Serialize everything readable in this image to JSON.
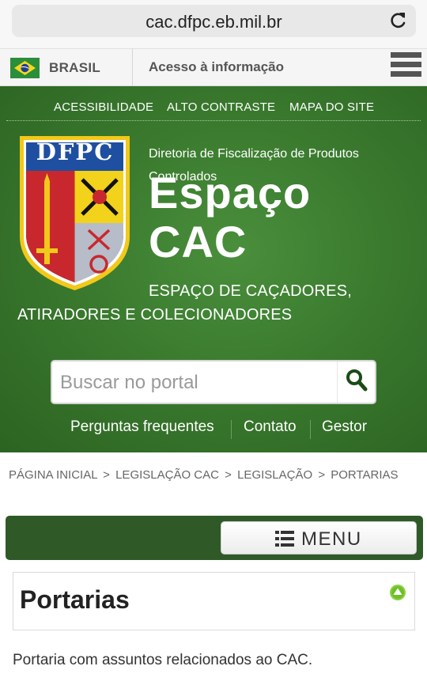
{
  "browser": {
    "url": "cac.dfpc.eb.mil.br",
    "reload_icon": "reload-icon"
  },
  "govbar": {
    "country": "BRASIL",
    "access_info": "Acesso à informação",
    "flag_icon": "brazil-flag-icon",
    "menu_icon": "hamburger-menu-icon"
  },
  "accessibility_links": [
    "ACESSIBILIDADE",
    "ALTO CONTRASTE",
    "MAPA DO SITE"
  ],
  "header": {
    "org_name": "Diretoria de Fiscalização de Produtos Controlados",
    "site_title_line1": "Espaço",
    "site_title_line2": "CAC",
    "subtitle_line1": "ESPAÇO DE CAÇADORES,",
    "subtitle_line2": "ATIRADORES E COLECIONADORES",
    "crest_text": "DFPC"
  },
  "search": {
    "placeholder": "Buscar no portal",
    "button_icon": "search-icon"
  },
  "quick_links": [
    "Perguntas frequentes",
    "Contato",
    "Gestor"
  ],
  "breadcrumb": [
    "PÁGINA INICIAL",
    "LEGISLAÇÃO CAC",
    "LEGISLAÇÃO",
    "PORTARIAS"
  ],
  "breadcrumb_separator": ">",
  "menu": {
    "label": "MENU",
    "icon": "list-icon"
  },
  "content": {
    "title": "Portarias",
    "intro": "Portaria com assuntos relacionados ao CAC.",
    "collapse_icon": "arrow-up-circle-icon"
  },
  "colors": {
    "header_green": "#3a7a2e",
    "menubar_green": "#2f5a28",
    "accent_green": "#6fbf2a"
  }
}
